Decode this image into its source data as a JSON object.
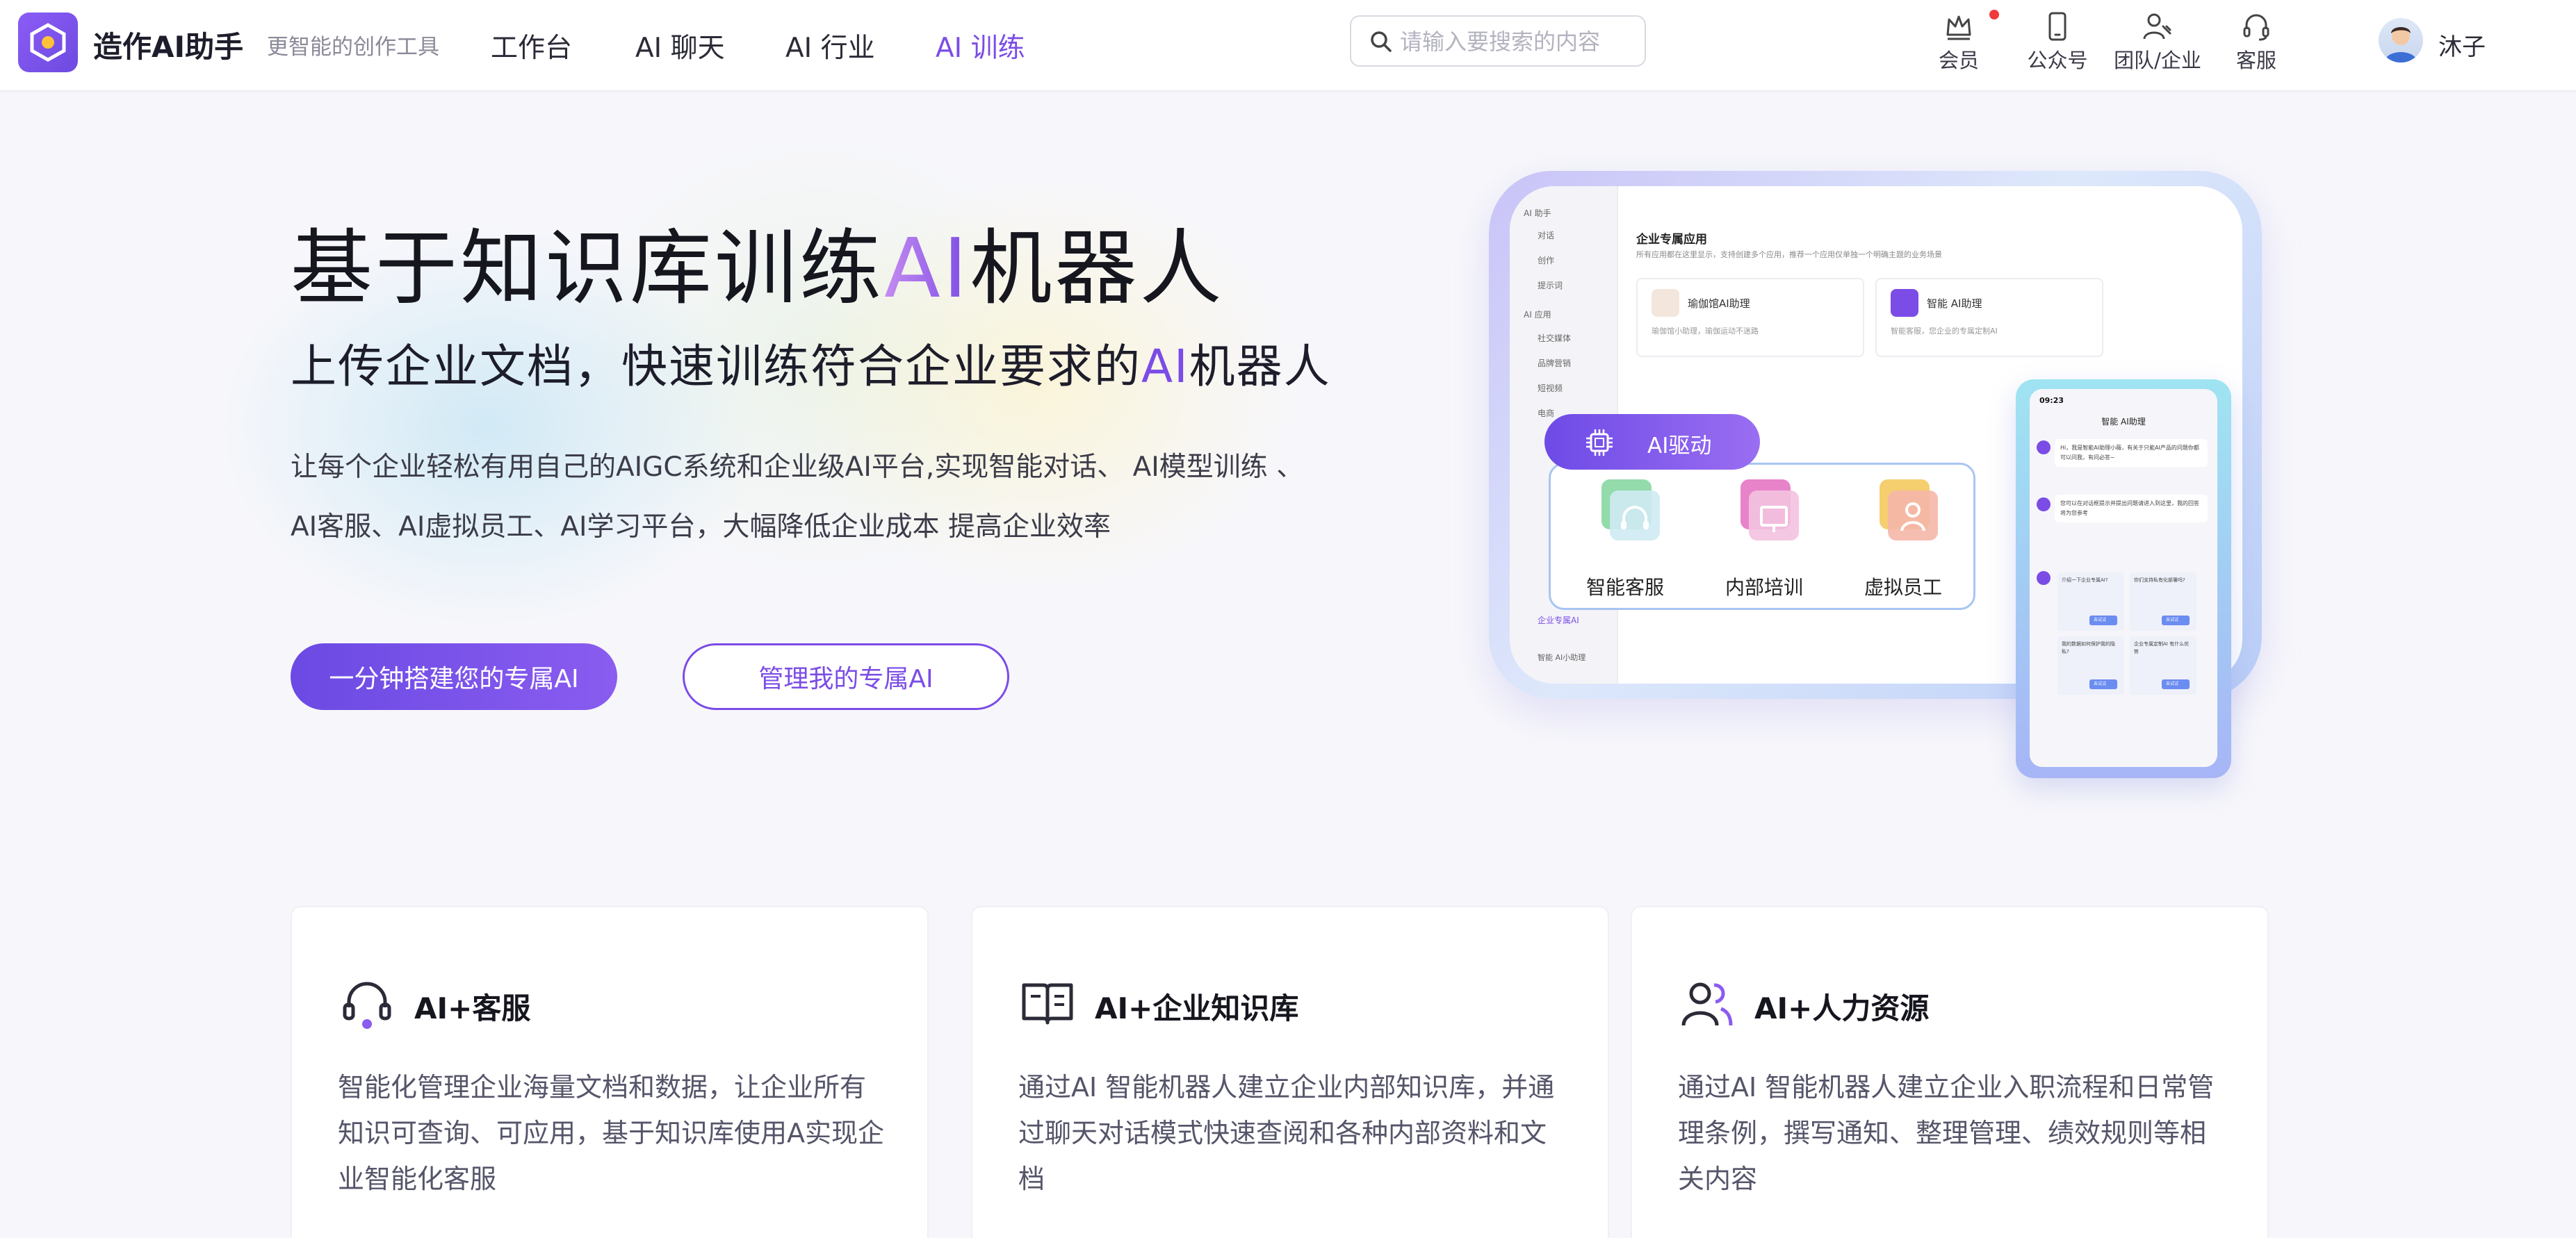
{
  "header": {
    "brand": "造作AI助手",
    "slogan": "更智能的创作工具",
    "nav": [
      {
        "label": "工作台",
        "active": false
      },
      {
        "label": "AI 聊天",
        "active": false
      },
      {
        "label": "AI 行业",
        "active": false
      },
      {
        "label": "AI 训练",
        "active": true
      }
    ],
    "search": {
      "placeholder": "请输入要搜索的内容",
      "value": ""
    },
    "actions": [
      {
        "label": "会员",
        "icon": "crown-icon"
      },
      {
        "label": "公众号",
        "icon": "phone-icon"
      },
      {
        "label": "团队/企业",
        "icon": "team-icon"
      },
      {
        "label": "客服",
        "icon": "headset-icon"
      }
    ],
    "user": {
      "name": "沐子"
    }
  },
  "hero": {
    "title_before": "基于知识库训练",
    "title_accent": "AI",
    "title_after": "机器人",
    "subtitle_before": "上传企业文档，快速训练符合企业要求的",
    "subtitle_accent": "AI",
    "subtitle_after": "机器人",
    "desc_line1": "让每个企业轻松有用自己的AIGC系统和企业级AI平台,实现智能对话、 AI模型训练 、",
    "desc_line2": "AI客服、AI虚拟员工、AI学习平台，大幅降低企业成本 提高企业效率",
    "primary_button": "一分钟搭建您的专属AI",
    "secondary_button": "管理我的专属AI"
  },
  "mockup": {
    "tablet": {
      "sidebar": [
        "AI 助手",
        "对话",
        "创作",
        "提示词",
        "AI 应用",
        "社交媒体",
        "品牌营销",
        "短视频",
        "电商",
        "企业专属AI",
        "智能 AI小助理"
      ],
      "title": "企业专属应用",
      "desc": "所有应用都在这里显示，支持创建多个应用，推荐一个应用仅单独一个明确主题的业务场景",
      "cards": [
        {
          "title": "瑜伽馆AI助理",
          "desc": "瑜伽馆小助理，瑜伽运动不迷路"
        },
        {
          "title": "智能 AI助理",
          "desc": "智能客服，您企业的专属定制AI"
        }
      ]
    },
    "drive": {
      "label": "AI驱动",
      "items": [
        "智能客服",
        "内部培训",
        "虚拟员工"
      ]
    },
    "phone": {
      "time": "09:23",
      "title": "智能 AI助理",
      "msg1": "Hi，我是智能AI助理小薇，有关于只能AI产品的问题你都可以问我，有问必答~",
      "msg2": "您可以在对话框提示并提出问题请进入到这里，我的回答将为您参考",
      "mini": [
        "介绍一下企业专属AI?",
        "你们支持私有化部署吗?",
        "我的数据如何保护我的隐私?",
        "企业专属定制AI 有什么优势"
      ],
      "mini_btn": "去试试"
    }
  },
  "features": [
    {
      "icon": "headset-icon",
      "title": "AI+客服",
      "desc": "智能化管理企业海量文档和数据，让企业所有知识可查询、可应用，基于知识库使用A实现企业智能化客服"
    },
    {
      "icon": "book-icon",
      "title": "AI+企业知识库",
      "desc": "通过AI 智能机器人建立企业内部知识库，并通过聊天对话模式快速查阅和各种内部资料和文档"
    },
    {
      "icon": "people-icon",
      "title": "AI+人力资源",
      "desc": "通过AI 智能机器人建立企业入职流程和日常管理条例，撰写通知、整理管理、绩效规则等相关内容"
    }
  ],
  "colors": {
    "accent": "#7b4ce6",
    "accent_light": "#c58cf0",
    "notice": "#ef3b3b"
  }
}
